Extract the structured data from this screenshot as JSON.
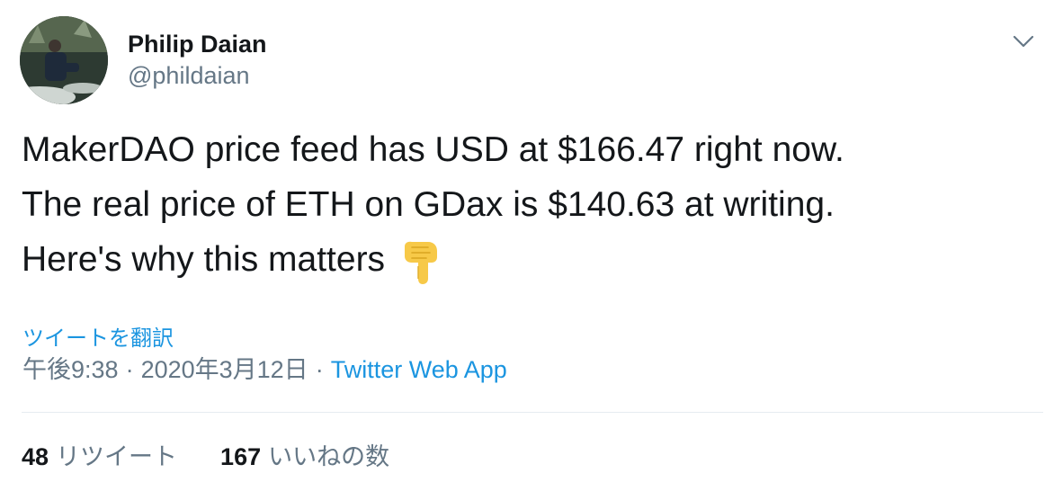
{
  "user": {
    "display_name": "Philip Daian",
    "handle": "@phildaian"
  },
  "tweet": {
    "lines": [
      "MakerDAO price feed has USD at $166.47 right now.",
      "The real price of ETH on GDax is $140.63 at writing.",
      "Here's why this matters"
    ],
    "emoji": "backhand-index-pointing-down"
  },
  "translate_label": "ツイートを翻訳",
  "meta": {
    "time": "午後9:38",
    "separator": "·",
    "date": "2020年3月12日",
    "app": "Twitter Web App"
  },
  "stats": {
    "retweets_count": "48",
    "retweets_label": "リツイート",
    "likes_count": "167",
    "likes_label": "いいねの数"
  },
  "icons": {
    "menu": "chevron-down-icon"
  },
  "colors": {
    "text": "#14171a",
    "secondary": "#657786",
    "link": "#1b95e0",
    "divider": "#e6ecf0"
  }
}
